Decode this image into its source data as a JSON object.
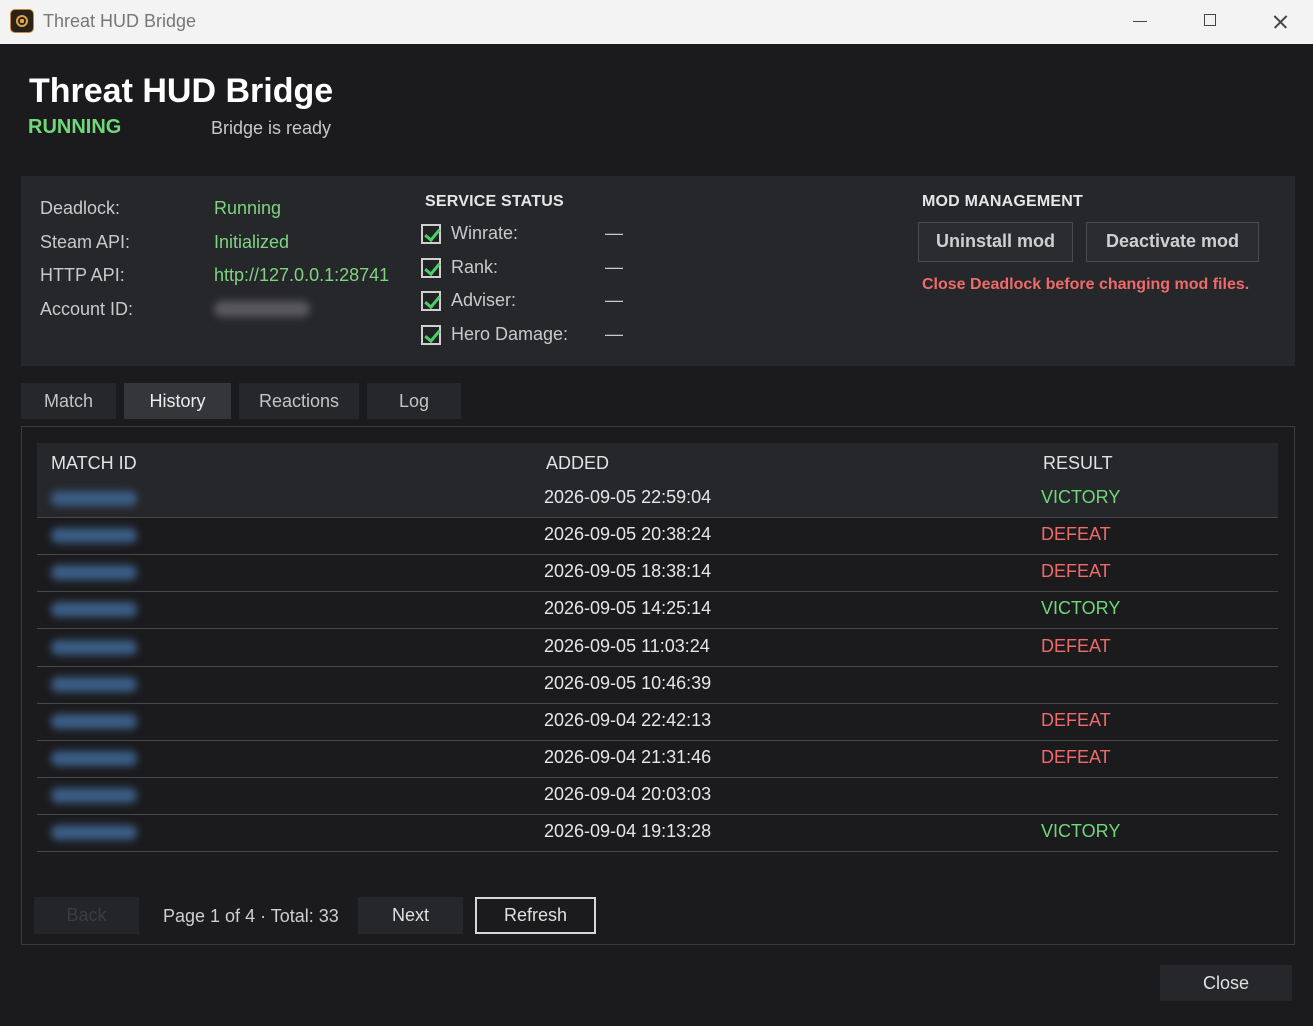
{
  "window": {
    "title": "Threat HUD Bridge"
  },
  "header": {
    "title": "Threat HUD Bridge",
    "state": "RUNNING",
    "message": "Bridge is ready"
  },
  "status": {
    "deadlock_label": "Deadlock:",
    "deadlock_value": "Running",
    "steam_label": "Steam API:",
    "steam_value": "Initialized",
    "http_label": "HTTP API:",
    "http_value": "http://127.0.0.1:28741",
    "account_label": "Account ID:"
  },
  "service": {
    "heading": "SERVICE STATUS",
    "items": [
      {
        "label": "Winrate:",
        "value": "—",
        "checked": true
      },
      {
        "label": "Rank:",
        "value": "—",
        "checked": true
      },
      {
        "label": "Adviser:",
        "value": "—",
        "checked": true
      },
      {
        "label": "Hero Damage:",
        "value": "—",
        "checked": true
      }
    ]
  },
  "mod": {
    "heading": "MOD MANAGEMENT",
    "uninstall_label": "Uninstall mod",
    "deactivate_label": "Deactivate mod",
    "warning": "Close Deadlock before changing mod files."
  },
  "tabs": [
    {
      "label": "Match",
      "active": false
    },
    {
      "label": "History",
      "active": true
    },
    {
      "label": "Reactions",
      "active": false
    },
    {
      "label": "Log",
      "active": false
    }
  ],
  "history": {
    "columns": [
      "MATCH ID",
      "ADDED",
      "RESULT"
    ],
    "rows": [
      {
        "added": "2026-09-05 22:59:04",
        "result": "VICTORY"
      },
      {
        "added": "2026-09-05 20:38:24",
        "result": "DEFEAT"
      },
      {
        "added": "2026-09-05 18:38:14",
        "result": "DEFEAT"
      },
      {
        "added": "2026-09-05 14:25:14",
        "result": "VICTORY"
      },
      {
        "added": "2026-09-05 11:03:24",
        "result": "DEFEAT"
      },
      {
        "added": "2026-09-05 10:46:39",
        "result": ""
      },
      {
        "added": "2026-09-04 22:42:13",
        "result": "DEFEAT"
      },
      {
        "added": "2026-09-04 21:31:46",
        "result": "DEFEAT"
      },
      {
        "added": "2026-09-04 20:03:03",
        "result": ""
      },
      {
        "added": "2026-09-04 19:13:28",
        "result": "VICTORY"
      }
    ]
  },
  "pager": {
    "back_label": "Back",
    "info": "Page 1 of 4 · Total: 33",
    "next_label": "Next",
    "refresh_label": "Refresh"
  },
  "footer": {
    "close_label": "Close"
  },
  "colors": {
    "ok": "#6fd97a",
    "error": "#f06a6a",
    "background": "#1b1b1d",
    "panel": "#26272a"
  }
}
